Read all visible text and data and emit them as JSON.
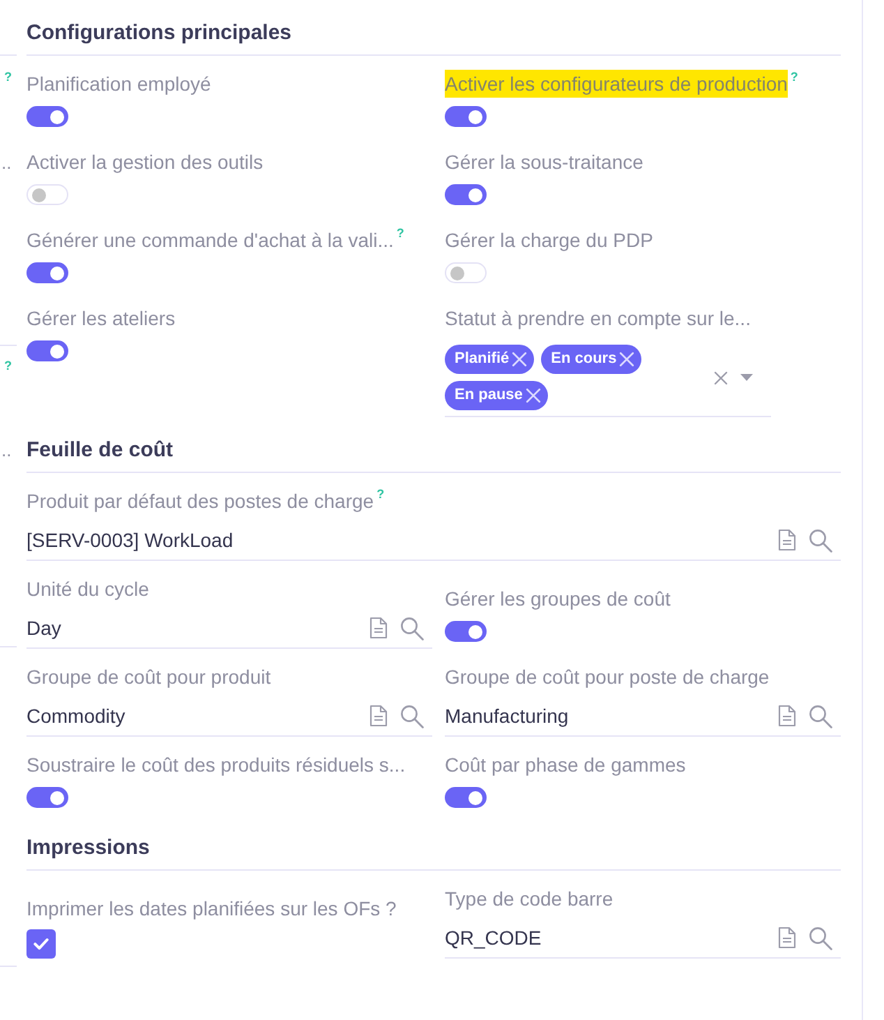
{
  "left_edge": {
    "marks": [
      "?",
      "..",
      "?",
      ".."
    ]
  },
  "sections": [
    {
      "title": "Configurations principales",
      "rows": [
        [
          {
            "kind": "toggle",
            "label": "Planification employé",
            "on": true
          },
          {
            "kind": "toggle",
            "label": "Activer les configurateurs de production",
            "highlighted": true,
            "help": "?",
            "on": true
          }
        ],
        [
          {
            "kind": "toggle",
            "label": "Activer la gestion des outils",
            "on": false
          },
          {
            "kind": "toggle",
            "label": "Gérer la sous-traitance",
            "on": true
          }
        ],
        [
          {
            "kind": "toggle",
            "label": "Générer une commande d'achat à la vali...",
            "help": "?",
            "on": true
          },
          {
            "kind": "toggle",
            "label": "Gérer la charge du PDP",
            "on": false
          }
        ],
        [
          {
            "kind": "toggle",
            "label": "Gérer les ateliers",
            "on": true
          },
          {
            "kind": "tags",
            "label": "Statut à prendre en compte sur le...",
            "tags": [
              "Planifié",
              "En cours",
              "En pause"
            ]
          }
        ]
      ]
    },
    {
      "title": "Feuille de coût",
      "rows": [
        [
          {
            "kind": "lookup",
            "label": "Produit par défaut des postes de charge",
            "help": "?",
            "value": "[SERV-0003] WorkLoad"
          }
        ],
        [
          {
            "kind": "lookup",
            "label": "Unité du cycle",
            "value": "Day"
          },
          {
            "kind": "toggle",
            "label": "Gérer les groupes de coût",
            "on": true
          }
        ],
        [
          {
            "kind": "lookup",
            "label": "Groupe de coût pour produit",
            "value": "Commodity"
          },
          {
            "kind": "lookup",
            "label": "Groupe de coût pour poste de charge",
            "value": "Manufacturing"
          }
        ],
        [
          {
            "kind": "toggle",
            "label": "Soustraire le coût des produits résiduels s...",
            "on": true
          },
          {
            "kind": "toggle",
            "label": "Coût par phase de gammes",
            "on": true
          }
        ]
      ]
    },
    {
      "title": "Impressions",
      "rows": [
        [
          {
            "kind": "checkbox",
            "label": "Imprimer les dates planifiées sur les OFs ?",
            "checked": true
          },
          {
            "kind": "lookup",
            "label": "Type de code barre",
            "value": "QR_CODE"
          }
        ]
      ]
    }
  ]
}
